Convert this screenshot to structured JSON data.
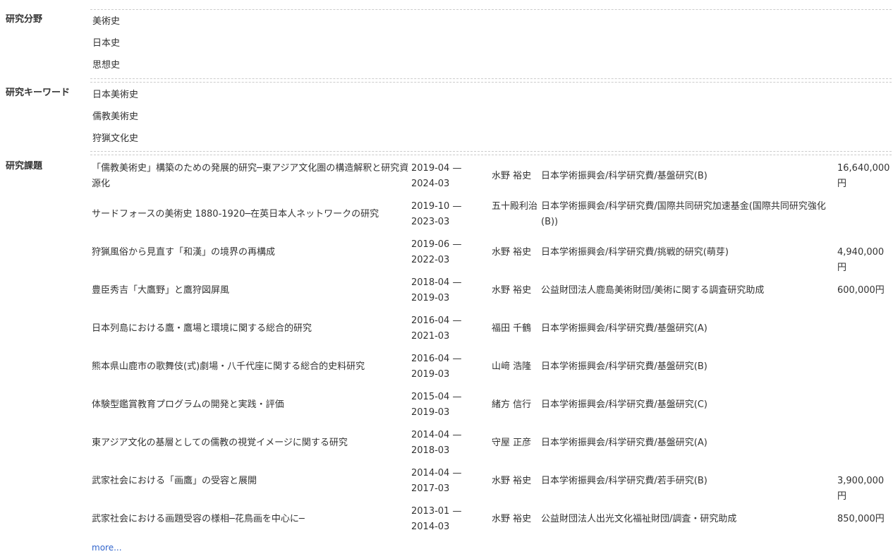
{
  "fields": {
    "label": "研究分野",
    "items": [
      "美術史",
      "日本史",
      "思想史"
    ]
  },
  "keywords": {
    "label": "研究キーワード",
    "items": [
      "日本美術史",
      "儒教美術史",
      "狩猟文化史"
    ]
  },
  "projects": {
    "label": "研究課題",
    "rows": [
      {
        "title": "「儒教美術史」構築のための発展的研究─東アジア文化圏の構造解釈と研究資源化",
        "period": "2019-04 — 2024-03",
        "person": "水野 裕史",
        "funder": "日本学術振興会/科学研究費/基盤研究(B)",
        "amount": "16,640,000円"
      },
      {
        "title": "サードフォースの美術史 1880-1920─在英日本人ネットワークの研究",
        "period": "2019-10 — 2023-03",
        "person": "五十殿利治",
        "funder": "日本学術振興会/科学研究費/国際共同研究加速基金(国際共同研究強化(B))",
        "amount": ""
      },
      {
        "title": "狩猟風俗から見直す「和漢」の境界の再構成",
        "period": "2019-06 — 2022-03",
        "person": "水野 裕史",
        "funder": "日本学術振興会/科学研究費/挑戦的研究(萌芽)",
        "amount": "4,940,000円"
      },
      {
        "title": "豊臣秀吉「大鷹野」と鷹狩図屏風",
        "period": "2018-04 — 2019-03",
        "person": "水野 裕史",
        "funder": "公益財団法人鹿島美術財団/美術に関する調査研究助成",
        "amount": "600,000円"
      },
      {
        "title": "日本列島における鷹・鷹場と環境に関する総合的研究",
        "period": "2016-04 — 2021-03",
        "person": "福田 千鶴",
        "funder": "日本学術振興会/科学研究費/基盤研究(A)",
        "amount": ""
      },
      {
        "title": "熊本県山鹿市の歌舞伎(式)劇場・八千代座に関する総合的史料研究",
        "period": "2016-04 — 2019-03",
        "person": "山﨑 浩隆",
        "funder": "日本学術振興会/科学研究費/基盤研究(B)",
        "amount": ""
      },
      {
        "title": "体験型鑑賞教育プログラムの開発と実践・評価",
        "period": "2015-04 — 2019-03",
        "person": "緒方 信行",
        "funder": "日本学術振興会/科学研究費/基盤研究(C)",
        "amount": ""
      },
      {
        "title": "東アジア文化の基層としての儒教の視覚イメージに関する研究",
        "period": "2014-04 — 2018-03",
        "person": "守屋 正彦",
        "funder": "日本学術振興会/科学研究費/基盤研究(A)",
        "amount": ""
      },
      {
        "title": "武家社会における「画鷹」の受容と展開",
        "period": "2014-04 — 2017-03",
        "person": "水野 裕史",
        "funder": "日本学術振興会/科学研究費/若手研究(B)",
        "amount": "3,900,000円"
      },
      {
        "title": "武家社会における画題受容の様相─花鳥画を中心に─",
        "period": "2013-01 — 2014-03",
        "person": "水野 裕史",
        "funder": "公益財団法人出光文化福祉財団/調査・研究助成",
        "amount": "850,000円"
      }
    ],
    "more_label": "more..."
  }
}
